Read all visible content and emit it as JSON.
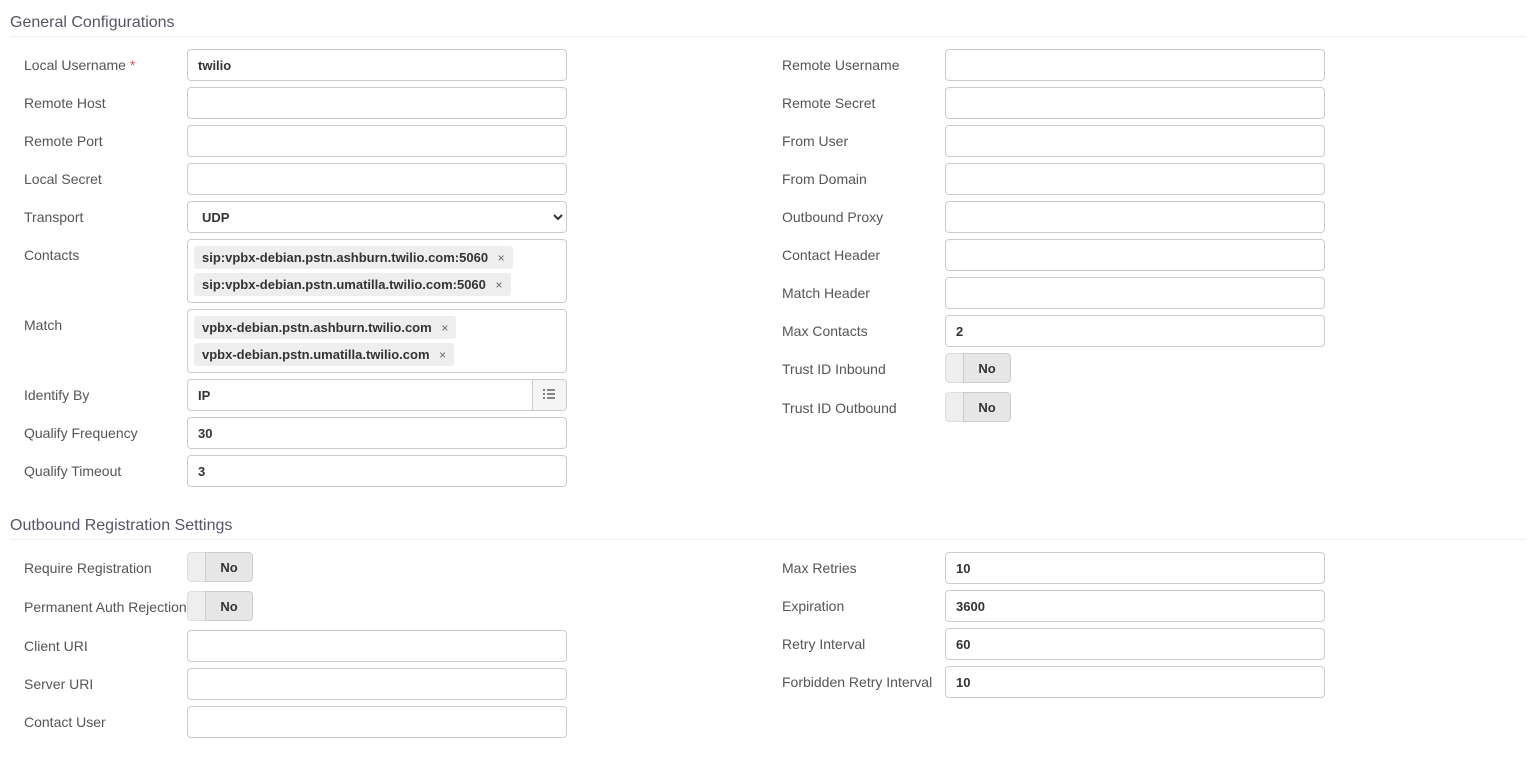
{
  "sections": {
    "general": {
      "title": "General Configurations",
      "left": {
        "local_username": {
          "label": "Local Username",
          "required": "*",
          "value": "twilio"
        },
        "remote_host": {
          "label": "Remote Host",
          "value": ""
        },
        "remote_port": {
          "label": "Remote Port",
          "value": ""
        },
        "local_secret": {
          "label": "Local Secret",
          "value": ""
        },
        "transport": {
          "label": "Transport",
          "value": "UDP"
        },
        "contacts": {
          "label": "Contacts",
          "items": [
            "sip:vpbx-debian.pstn.ashburn.twilio.com:5060",
            "sip:vpbx-debian.pstn.umatilla.twilio.com:5060"
          ]
        },
        "match": {
          "label": "Match",
          "items": [
            "vpbx-debian.pstn.ashburn.twilio.com",
            "vpbx-debian.pstn.umatilla.twilio.com"
          ]
        },
        "identify_by": {
          "label": "Identify By",
          "value": "IP"
        },
        "qualify_frequency": {
          "label": "Qualify Frequency",
          "value": "30"
        },
        "qualify_timeout": {
          "label": "Qualify Timeout",
          "value": "3"
        }
      },
      "right": {
        "remote_username": {
          "label": "Remote Username",
          "value": ""
        },
        "remote_secret": {
          "label": "Remote Secret",
          "value": ""
        },
        "from_user": {
          "label": "From User",
          "value": ""
        },
        "from_domain": {
          "label": "From Domain",
          "value": ""
        },
        "outbound_proxy": {
          "label": "Outbound Proxy",
          "value": ""
        },
        "contact_header": {
          "label": "Contact Header",
          "value": ""
        },
        "match_header": {
          "label": "Match Header",
          "value": ""
        },
        "max_contacts": {
          "label": "Max Contacts",
          "value": "2"
        },
        "trust_id_inbound": {
          "label": "Trust ID Inbound",
          "value": "No"
        },
        "trust_id_outbound": {
          "label": "Trust ID Outbound",
          "value": "No"
        }
      }
    },
    "outbound": {
      "title": "Outbound Registration Settings",
      "left": {
        "require_registration": {
          "label": "Require Registration",
          "value": "No"
        },
        "permanent_auth_rejection": {
          "label": "Permanent Auth Rejection",
          "value": "No"
        },
        "client_uri": {
          "label": "Client URI",
          "value": ""
        },
        "server_uri": {
          "label": "Server URI",
          "value": ""
        },
        "contact_user": {
          "label": "Contact User",
          "value": ""
        }
      },
      "right": {
        "max_retries": {
          "label": "Max Retries",
          "value": "10"
        },
        "expiration": {
          "label": "Expiration",
          "value": "3600"
        },
        "retry_interval": {
          "label": "Retry Interval",
          "value": "60"
        },
        "forbidden_retry_interval": {
          "label": "Forbidden Retry Interval",
          "value": "10"
        }
      }
    }
  }
}
